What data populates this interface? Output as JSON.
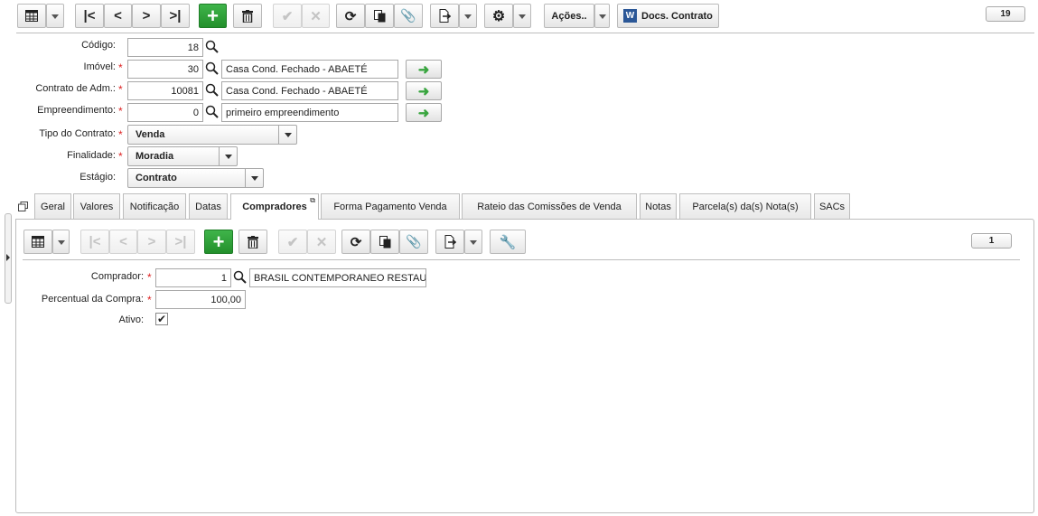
{
  "toolbar": {
    "actions_label": "Ações..",
    "docs_label": "Docs. Contrato",
    "record_count": "19"
  },
  "form": {
    "codigo": {
      "label": "Código:",
      "value": "18"
    },
    "imovel": {
      "label": "Imóvel:",
      "value": "30",
      "desc": "Casa Cond. Fechado - ABAETÉ"
    },
    "contrato_adm": {
      "label": "Contrato de Adm.:",
      "value": "10081",
      "desc": "Casa Cond. Fechado - ABAETÉ"
    },
    "empreendimento": {
      "label": "Empreendimento:",
      "value": "0",
      "desc": "primeiro empreendimento"
    },
    "tipo_contrato": {
      "label": "Tipo do Contrato:",
      "value": "Venda"
    },
    "finalidade": {
      "label": "Finalidade:",
      "value": "Moradia"
    },
    "estagio": {
      "label": "Estágio:",
      "value": "Contrato"
    }
  },
  "tabs": [
    {
      "label": "Geral"
    },
    {
      "label": "Valores"
    },
    {
      "label": "Notificação"
    },
    {
      "label": "Datas"
    },
    {
      "label": "Compradores",
      "active": true
    },
    {
      "label": "Forma Pagamento Venda"
    },
    {
      "label": "Rateio das Comissões de Venda"
    },
    {
      "label": "Notas"
    },
    {
      "label": "Parcela(s) da(s) Nota(s)"
    },
    {
      "label": "SACs"
    }
  ],
  "sub": {
    "record_count": "1",
    "comprador": {
      "label": "Comprador:",
      "value": "1",
      "desc": "BRASIL CONTEMPORANEO RESTAU"
    },
    "percentual": {
      "label": "Percentual da Compra:",
      "value": "100,00"
    },
    "ativo": {
      "label": "Ativo:",
      "checked": true
    }
  },
  "colors": {
    "green": "#2a9a34",
    "required": "#d22222",
    "border": "#bdbdbd"
  }
}
